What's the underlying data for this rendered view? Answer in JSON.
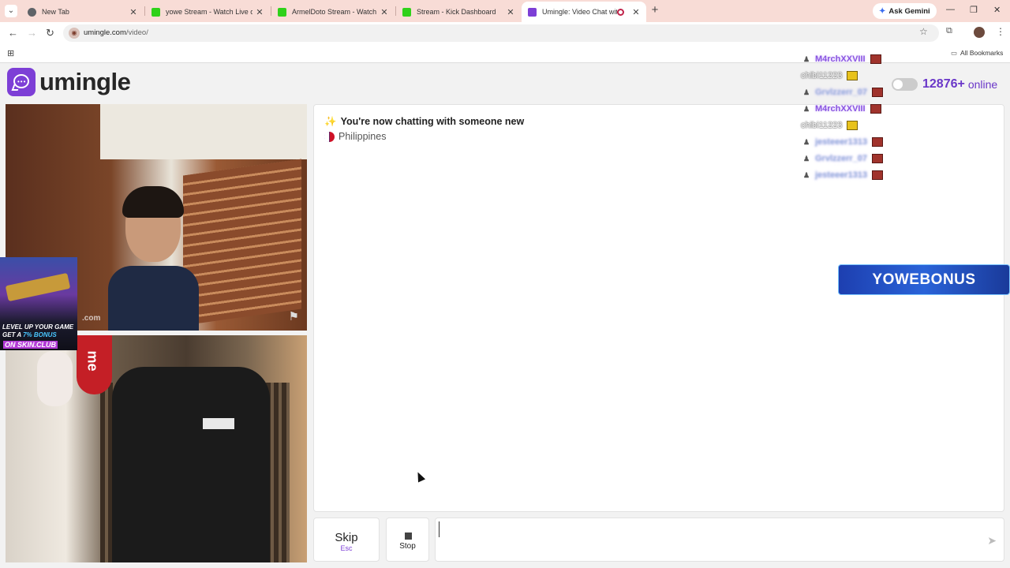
{
  "browser": {
    "tabs": [
      {
        "title": "New Tab",
        "favicon_color": "#5f6368",
        "active": false
      },
      {
        "title": "yowe Stream - Watch Live on Ki",
        "favicon_color": "#2fd11a",
        "active": false
      },
      {
        "title": "ArmelDoto Stream - Watch Live",
        "favicon_color": "#2fd11a",
        "active": false
      },
      {
        "title": "Stream - Kick Dashboard",
        "favicon_color": "#2fd11a",
        "active": false
      },
      {
        "title": "Umingle: Video Chat with S",
        "favicon_color": "#7d3fd6",
        "active": true
      }
    ],
    "ask_gemini": "Ask Gemini",
    "url_host": "umingle.com",
    "url_path": "/video/",
    "all_bookmarks": "All Bookmarks"
  },
  "site": {
    "logo_text": "umingle",
    "brand_color": "#7d3fd6",
    "online_count": "12876+",
    "online_label": "online"
  },
  "chat": {
    "status_message": "You're now chatting with someone new",
    "status_icon": "sparkles-icon",
    "country": "Philippines",
    "input_value": "",
    "video_watermark": ".com"
  },
  "controls": {
    "skip_label": "Skip",
    "skip_hint": "Esc",
    "stop_label": "Stop"
  },
  "overlay": {
    "viewers": [
      {
        "name": "M4rchXXVIII",
        "style": "purple",
        "badge": "red"
      },
      {
        "name": "chibi11223",
        "style": "white",
        "badge": "gold"
      },
      {
        "name": "Grvlzzerr_07",
        "style": "blur",
        "badge": "red"
      },
      {
        "name": "M4rchXXVIII",
        "style": "purple",
        "badge": "red"
      },
      {
        "name": "chibi11223",
        "style": "white",
        "badge": "gold"
      },
      {
        "name": "jesteeer1313",
        "style": "blur",
        "badge": "red"
      },
      {
        "name": "Grvlzzerr_07",
        "style": "blur",
        "badge": "red"
      },
      {
        "name": "jesteeer1313",
        "style": "blur",
        "badge": "red"
      }
    ],
    "bonus_banner": "YOWEBONUS",
    "ad": {
      "line1": "LEVEL UP YOUR GAME",
      "line2_prefix": "GET A ",
      "line2_highlight": "7% BONUS",
      "cta": "ON SKIN.CLUB"
    }
  }
}
